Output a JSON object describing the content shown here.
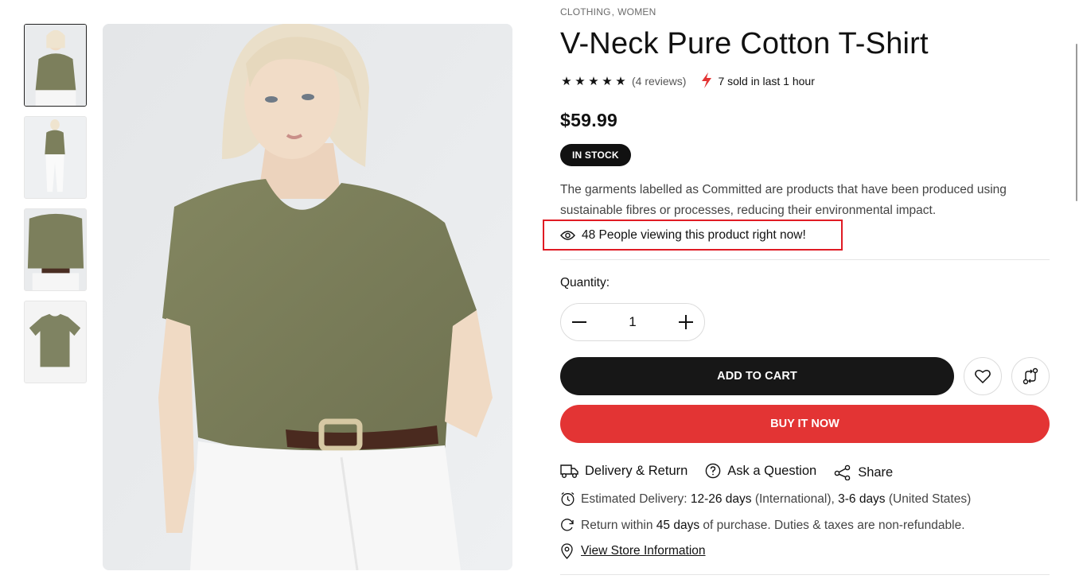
{
  "breadcrumb": {
    "cat1": "CLOTHING",
    "sep": ",",
    "cat2": "WOMEN"
  },
  "product": {
    "title": "V-Neck Pure Cotton T-Shirt",
    "rating": 5,
    "reviews": "(4 reviews)",
    "sold": "7 sold in last 1 hour",
    "price": "$59.99",
    "stock": "IN STOCK",
    "description": "The garments labelled as Committed are products that have been produced using sustainable fibres or processes, reducing their environmental impact.",
    "viewing": "48 People viewing this product right now!"
  },
  "quantity": {
    "label": "Quantity:",
    "value": "1"
  },
  "buttons": {
    "add_to_cart": "ADD TO CART",
    "buy_now": "BUY IT NOW"
  },
  "actions": {
    "delivery": "Delivery & Return",
    "ask": "Ask a Question",
    "share": "Share"
  },
  "delivery_info": {
    "prefix": "Estimated Delivery:",
    "intl_days": "12-26 days",
    "intl_label": "(International),",
    "us_days": "3-6 days",
    "us_label": "(United States)"
  },
  "return_info": {
    "prefix": "Return within",
    "days": "45 days",
    "suffix": "of purchase. Duties & taxes are non-refundable."
  },
  "store": {
    "link": "View Store Information"
  },
  "colors": {
    "accent_red": "#e33434",
    "highlight_border": "#e01b24",
    "dark": "#171717",
    "bolt": "#e33434",
    "shirt": "#7c7f5c"
  },
  "icons": [
    "star-icon",
    "bolt-icon",
    "eye-icon",
    "minus-icon",
    "plus-icon",
    "heart-icon",
    "compare-icon",
    "truck-icon",
    "question-icon",
    "share-icon",
    "clock-icon",
    "return-icon",
    "location-icon"
  ]
}
